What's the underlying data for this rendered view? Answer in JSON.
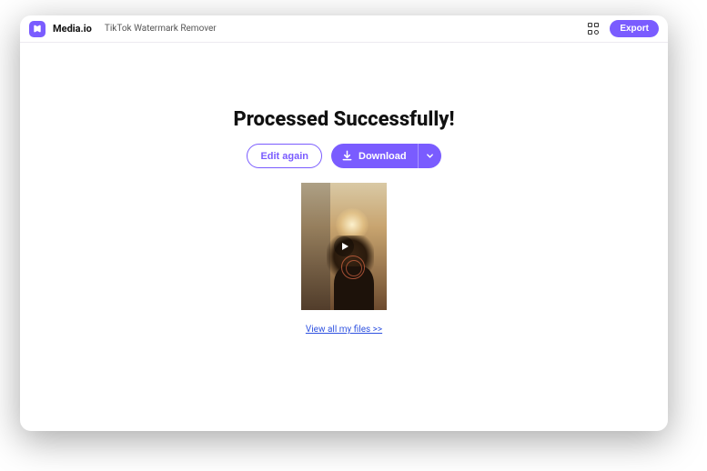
{
  "header": {
    "brand": "Media.io",
    "tool_name": "TikTok Watermark Remover",
    "export_label": "Export"
  },
  "main": {
    "title": "Processed Successfully!",
    "edit_label": "Edit again",
    "download_label": "Download",
    "view_files_label": "View all my files >>"
  },
  "colors": {
    "accent": "#7a5cff",
    "link": "#2f52e0"
  }
}
